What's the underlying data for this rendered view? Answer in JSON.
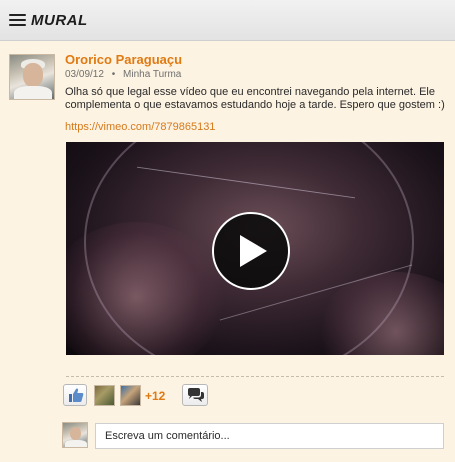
{
  "header": {
    "title": "MURAL",
    "menu_icon": "hamburger-menu-icon"
  },
  "post": {
    "author": "Ororico Paraguaçu",
    "date": "03/09/12",
    "separator": "•",
    "group": "Minha Turma",
    "text": "Olha só que legal esse vídeo que eu encontrei navegando pela internet. Ele complementa o que estavamos estudando hoje a tarde. Espero que gostem :)",
    "link": "https://vimeo.com/7879865131",
    "video": {
      "play_icon": "play-icon"
    }
  },
  "actions": {
    "like_icon": "thumbs-up-icon",
    "like_count": "+12",
    "comment_icon": "speech-bubbles-icon"
  },
  "comment": {
    "placeholder": "Escreva um comentário..."
  },
  "colors": {
    "accent": "#e07a12",
    "background": "#fdf3e2",
    "link": "#d67a1b"
  }
}
